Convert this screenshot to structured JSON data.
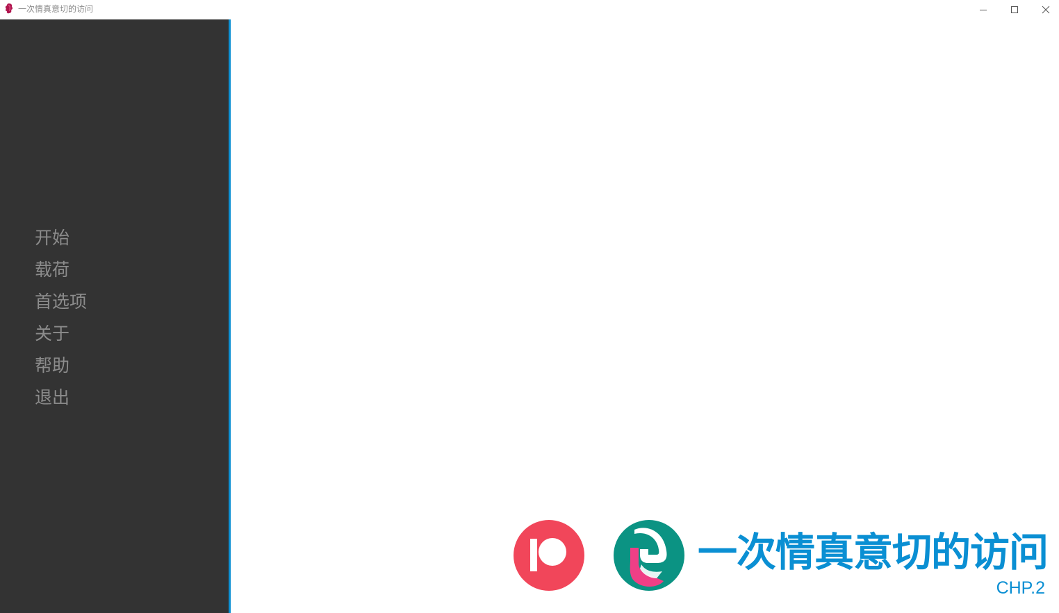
{
  "window": {
    "title": "一次情真意切的访问",
    "icon": "app-icon",
    "controls": {
      "minimize": "minimize-icon",
      "maximize": "maximize-icon",
      "close": "close-icon"
    }
  },
  "sidebar": {
    "items": [
      {
        "label": "开始",
        "id": "start"
      },
      {
        "label": "载荷",
        "id": "load"
      },
      {
        "label": "首选项",
        "id": "preferences"
      },
      {
        "label": "关于",
        "id": "about"
      },
      {
        "label": "帮助",
        "id": "help"
      },
      {
        "label": "退出",
        "id": "quit"
      }
    ]
  },
  "branding": {
    "game_title": "一次情真意切的访问",
    "chapter": "CHP.2",
    "patreon_icon": "patreon-icon",
    "game_logo_icon": "game-logo-icon"
  },
  "colors": {
    "sidebar_bg": "#333333",
    "menu_text": "#8c8c8c",
    "accent": "#0a8fd3",
    "patreon_red": "#f1465a",
    "logo_teal": "#0b9383",
    "logo_pink": "#ef3f86"
  }
}
